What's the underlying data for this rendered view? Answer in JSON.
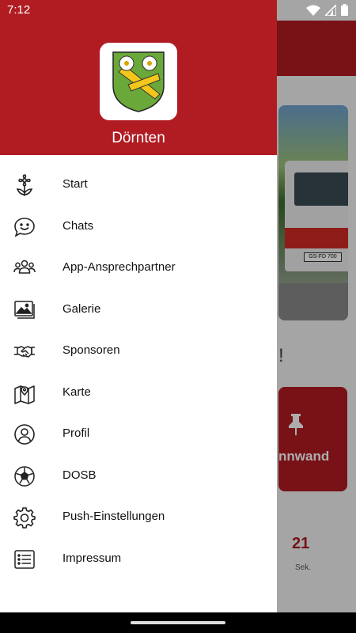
{
  "status_bar": {
    "time": "7:12"
  },
  "drawer": {
    "town_name": "Dörnten",
    "menu": [
      {
        "label": "Start",
        "icon": "flower-icon"
      },
      {
        "label": "Chats",
        "icon": "chat-smile-icon"
      },
      {
        "label": "App-Ansprechpartner",
        "icon": "people-group-icon"
      },
      {
        "label": "Galerie",
        "icon": "gallery-icon"
      },
      {
        "label": "Sponsoren",
        "icon": "handshake-icon"
      },
      {
        "label": "Karte",
        "icon": "map-icon"
      },
      {
        "label": "Profil",
        "icon": "profile-icon"
      },
      {
        "label": "DOSB",
        "icon": "soccer-ball-icon"
      },
      {
        "label": "Push-Einstellungen",
        "icon": "settings-gear-icon"
      },
      {
        "label": "Impressum",
        "icon": "list-icon"
      }
    ]
  },
  "background": {
    "plate_text": "GS-FD 700",
    "exclaim": "!",
    "pin_card_label": "nnwand",
    "countdown_value": "21",
    "countdown_unit": "Sek."
  },
  "colors": {
    "brand_red": "#b11b22",
    "drawer_bg": "#ffffff",
    "scrim": "rgba(0,0,0,0.32)"
  }
}
